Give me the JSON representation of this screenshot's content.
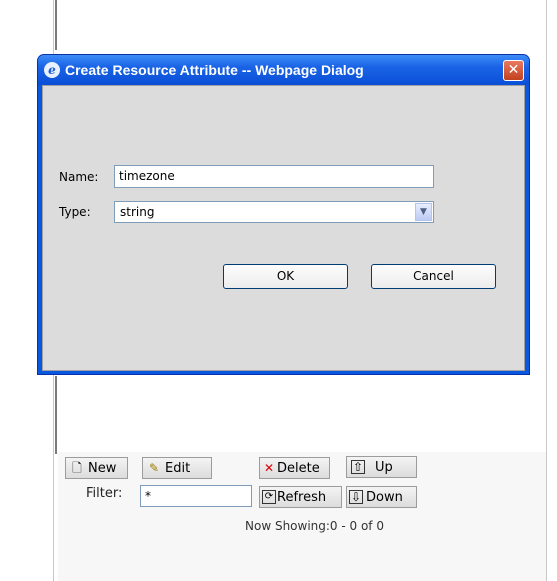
{
  "dialog": {
    "title": "Create Resource Attribute -- Webpage Dialog",
    "name_label": "Name:",
    "name_value": "timezone",
    "type_label": "Type:",
    "type_value": "string",
    "ok_label": "OK",
    "cancel_label": "Cancel",
    "close_glyph": "✕"
  },
  "toolbar": {
    "new_label": "New",
    "edit_label": "Edit",
    "delete_label": "Delete",
    "up_label": "Up",
    "refresh_label": "Refresh",
    "down_label": "Down",
    "filter_label": "Filter:",
    "filter_value": "*",
    "now_showing": "Now Showing:0 - 0 of 0"
  },
  "icons": {
    "ie": "e",
    "new": "🗋",
    "edit": "✎",
    "delete": "✕",
    "up": "⇧",
    "refresh": "⟳",
    "down": "⇩"
  }
}
